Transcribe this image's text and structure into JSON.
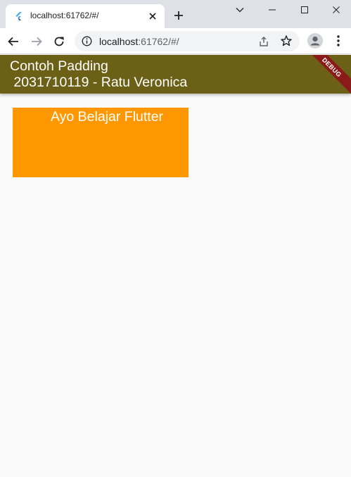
{
  "browser": {
    "tab_title": "localhost:61762/#/",
    "url_host": "localhost",
    "url_rest": ":61762/#/"
  },
  "app": {
    "title": "Contoh Padding\n 2031710119 - Ratu Veronica",
    "debug_label": "DEBUG",
    "appbar_color": "#6b6015"
  },
  "content": {
    "box_text": "Ayo Belajar Flutter",
    "box_color": "#ff9800"
  },
  "icons": {
    "favicon": "flutter-logo-icon",
    "tab_close": "close-icon",
    "new_tab": "plus-icon",
    "back": "arrow-left-icon",
    "forward": "arrow-right-icon",
    "reload": "reload-icon",
    "site_info": "info-icon",
    "share": "share-icon",
    "bookmark": "star-icon",
    "profile": "profile-icon",
    "menu": "kebab-menu-icon"
  }
}
